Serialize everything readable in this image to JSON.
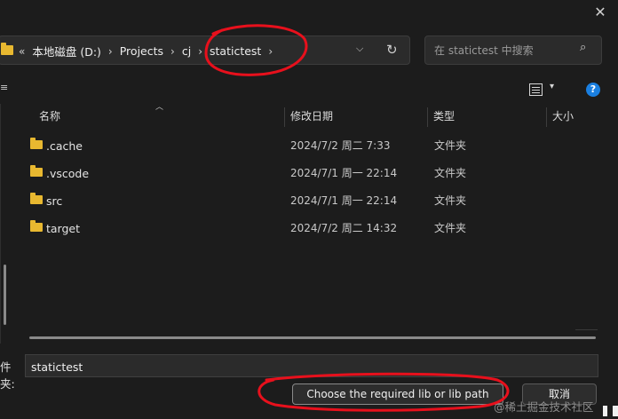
{
  "window": {
    "close_glyph": "✕"
  },
  "address_bar": {
    "overflow": "«",
    "crumbs": [
      "本地磁盘 (D:)",
      "Projects",
      "cj",
      "statictest"
    ],
    "separator": "›",
    "dropdown_glyph": "⌵",
    "refresh_glyph": "↻"
  },
  "search": {
    "placeholder": "在 statictest 中搜索",
    "icon": "⌕"
  },
  "toolbar": {
    "left_glyph": "≡",
    "view_caret": "▾",
    "help_label": "?"
  },
  "columns": {
    "name": "名称",
    "modified": "修改日期",
    "type": "类型",
    "size": "大小",
    "sort_glyph": "︿"
  },
  "files": [
    {
      "name": ".cache",
      "modified": "2024/7/2 周二 7:33",
      "type": "文件夹"
    },
    {
      "name": ".vscode",
      "modified": "2024/7/1 周一 22:14",
      "type": "文件夹"
    },
    {
      "name": "src",
      "modified": "2024/7/1 周一 22:14",
      "type": "文件夹"
    },
    {
      "name": "target",
      "modified": "2024/7/2 周二 14:32",
      "type": "文件夹"
    }
  ],
  "footer": {
    "filename_label": "件夹:",
    "filename_value": "statictest",
    "primary_button": "Choose the required lib or lib path",
    "cancel_button": "取消",
    "watermark": "@稀土掘金技术社区"
  },
  "colors": {
    "folder": "#e8b830",
    "annotation": "#e8101c",
    "help": "#1a7fe0"
  },
  "icons": [
    "folder-icon",
    "refresh-icon",
    "search-icon",
    "view-details-icon",
    "help-icon",
    "close-icon"
  ]
}
